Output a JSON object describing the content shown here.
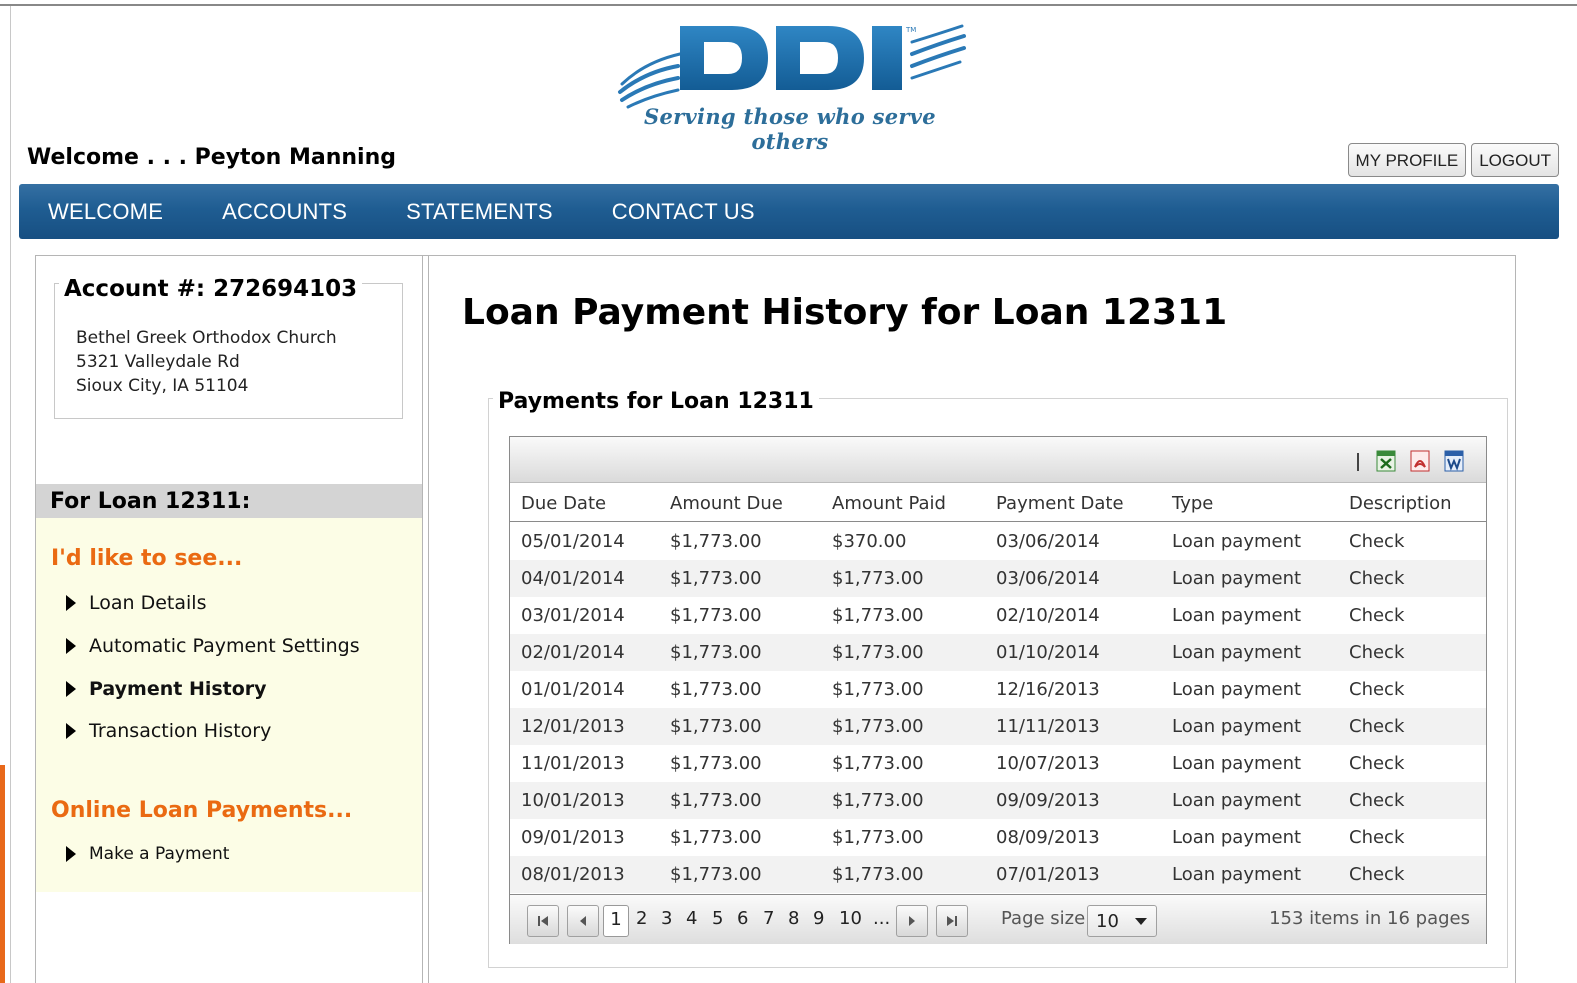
{
  "brand": {
    "logo_text": "DDI",
    "tagline": "Serving those who serve others"
  },
  "header": {
    "welcome": "Welcome . . . Peyton Manning",
    "my_profile": "MY PROFILE",
    "logout": "LOGOUT"
  },
  "nav": {
    "items": [
      "WELCOME",
      "ACCOUNTS",
      "STATEMENTS",
      "CONTACT US"
    ]
  },
  "sidebar": {
    "account_label": "Account #:  272694103",
    "address": [
      "Bethel Greek Orthodox Church",
      "5321 Valleydale Rd",
      "Sioux City, IA 51104"
    ],
    "for_loan": "For Loan 12311:",
    "see_heading": "I'd like to see...",
    "links": [
      "Loan Details",
      "Automatic Payment Settings",
      "Payment History",
      "Transaction History"
    ],
    "online_heading": "Online Loan Payments...",
    "make_payment": "Make a Payment"
  },
  "main": {
    "title": "Loan Payment History for Loan 12311",
    "section": "Payments for Loan 12311"
  },
  "grid": {
    "toolbar_icons": [
      "export-excel-icon",
      "export-pdf-icon",
      "export-word-icon"
    ],
    "columns": [
      "Due Date",
      "Amount Due",
      "Amount Paid",
      "Payment Date",
      "Type",
      "Description"
    ],
    "rows": [
      [
        "05/01/2014",
        "$1,773.00",
        "$370.00",
        "03/06/2014",
        "Loan payment",
        "Check"
      ],
      [
        "04/01/2014",
        "$1,773.00",
        "$1,773.00",
        "03/06/2014",
        "Loan payment",
        "Check"
      ],
      [
        "03/01/2014",
        "$1,773.00",
        "$1,773.00",
        "02/10/2014",
        "Loan payment",
        "Check"
      ],
      [
        "02/01/2014",
        "$1,773.00",
        "$1,773.00",
        "01/10/2014",
        "Loan payment",
        "Check"
      ],
      [
        "01/01/2014",
        "$1,773.00",
        "$1,773.00",
        "12/16/2013",
        "Loan payment",
        "Check"
      ],
      [
        "12/01/2013",
        "$1,773.00",
        "$1,773.00",
        "11/11/2013",
        "Loan payment",
        "Check"
      ],
      [
        "11/01/2013",
        "$1,773.00",
        "$1,773.00",
        "10/07/2013",
        "Loan payment",
        "Check"
      ],
      [
        "10/01/2013",
        "$1,773.00",
        "$1,773.00",
        "09/09/2013",
        "Loan payment",
        "Check"
      ],
      [
        "09/01/2013",
        "$1,773.00",
        "$1,773.00",
        "08/09/2013",
        "Loan payment",
        "Check"
      ],
      [
        "08/01/2013",
        "$1,773.00",
        "$1,773.00",
        "07/01/2013",
        "Loan payment",
        "Check"
      ]
    ]
  },
  "pager": {
    "pages": [
      "1",
      "2",
      "3",
      "4",
      "5",
      "6",
      "7",
      "8",
      "9",
      "10",
      "..."
    ],
    "current_page": "1",
    "page_size_label": "Page size:",
    "page_size": "10",
    "info": "153 items in 16 pages"
  },
  "colors": {
    "nav_blue": "#1f5d92",
    "accent_orange": "#ea6a12",
    "panel_yellow": "#fcfde6",
    "logo_blue": "#1d6aa5"
  }
}
